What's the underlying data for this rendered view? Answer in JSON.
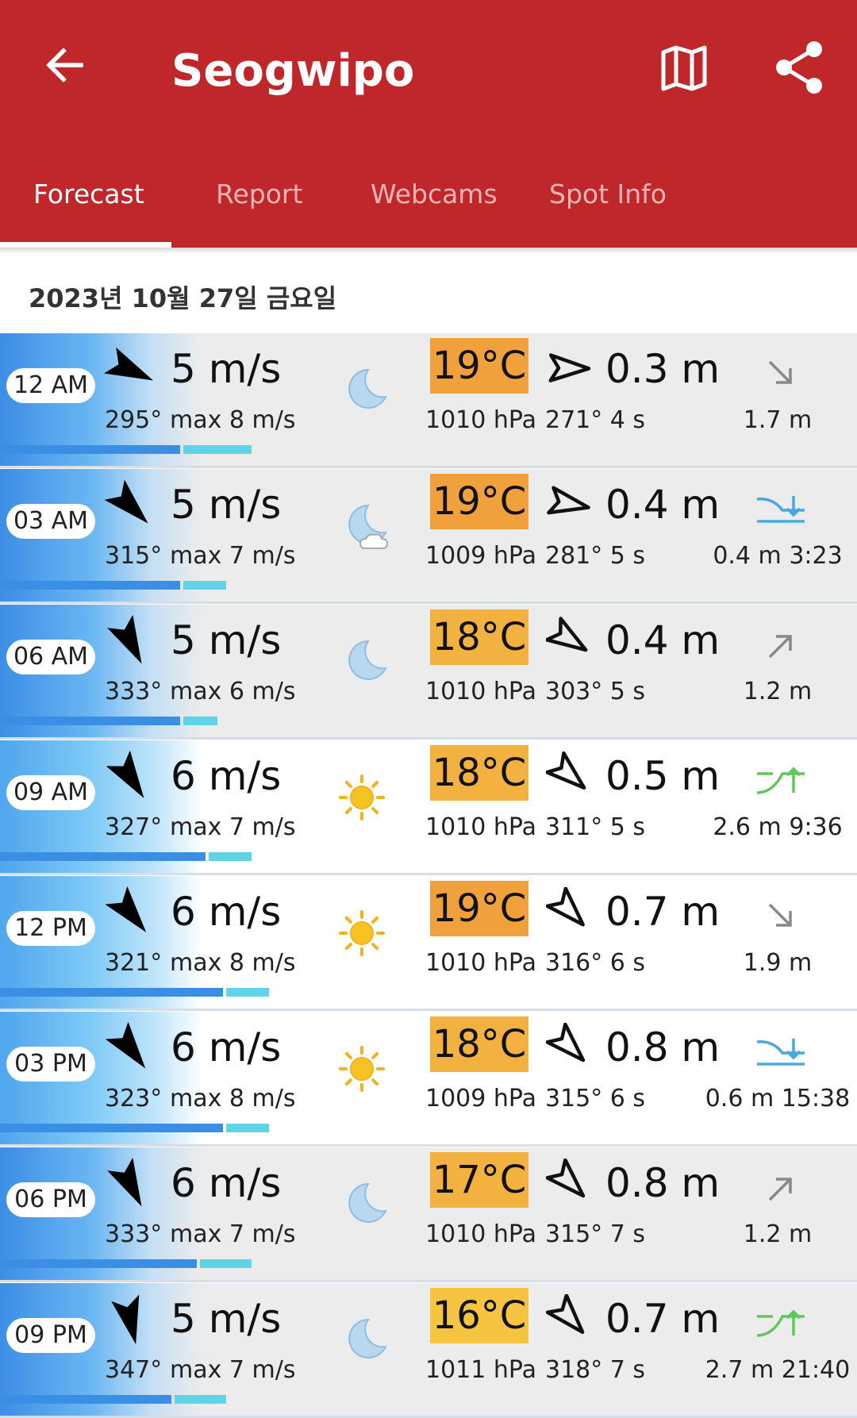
{
  "app": {
    "title": "Seogwipo",
    "icons": {
      "back": "arrow-left-icon",
      "map": "map-icon",
      "share": "share-icon"
    }
  },
  "tabs": [
    {
      "label": "Forecast",
      "active": true
    },
    {
      "label": "Report",
      "active": false
    },
    {
      "label": "Webcams",
      "active": false
    },
    {
      "label": "Spot Info",
      "active": false
    }
  ],
  "date": "2023년 10월 27일 금요일",
  "colors": {
    "appbar": "#bf272a",
    "temp_orange": "#f0a13c",
    "temp_light_orange": "#f3b23f",
    "temp_yellow": "#f5c542",
    "wind_bar": "#3a8fe5",
    "gust_bar": "#5fd4e6",
    "tide_rising": "#5ec85a",
    "tide_falling": "#4aa8e0"
  },
  "forecast": [
    {
      "time": "12 AM",
      "wind_speed": "5 m/s",
      "wind_deg": "295°",
      "wind_max": "max 8 m/s",
      "wind_dir": 295,
      "wind_frac": 0.21,
      "gust_frac": 0.29,
      "weather": "moon-icon",
      "period": "night",
      "temp": "19°C",
      "temp_color": "#f0a13c",
      "pressure": "1010 hPa",
      "swell_height": "0.3 m",
      "swell_info": "271° 4 s",
      "swell_dir": 271,
      "tide_type": "arrow-down-right-icon",
      "tide_text": "1.7 m"
    },
    {
      "time": "03 AM",
      "wind_speed": "5 m/s",
      "wind_deg": "315°",
      "wind_max": "max 7 m/s",
      "wind_dir": 315,
      "wind_frac": 0.21,
      "gust_frac": 0.26,
      "weather": "moon-cloud-icon",
      "period": "night",
      "temp": "19°C",
      "temp_color": "#f0a13c",
      "pressure": "1009 hPa",
      "swell_height": "0.4 m",
      "swell_info": "281° 5 s",
      "swell_dir": 281,
      "tide_type": "low-tide-icon",
      "tide_text": "0.4 m 3:23"
    },
    {
      "time": "06 AM",
      "wind_speed": "5 m/s",
      "wind_deg": "333°",
      "wind_max": "max 6 m/s",
      "wind_dir": 333,
      "wind_frac": 0.21,
      "gust_frac": 0.25,
      "weather": "moon-icon",
      "period": "night",
      "temp": "18°C",
      "temp_color": "#f3b23f",
      "pressure": "1010 hPa",
      "swell_height": "0.4 m",
      "swell_info": "303° 5 s",
      "swell_dir": 303,
      "tide_type": "arrow-up-right-icon",
      "tide_text": "1.2 m"
    },
    {
      "time": "09 AM",
      "wind_speed": "6 m/s",
      "wind_deg": "327°",
      "wind_max": "max 7 m/s",
      "wind_dir": 327,
      "wind_frac": 0.24,
      "gust_frac": 0.29,
      "weather": "sun-icon",
      "period": "day",
      "temp": "18°C",
      "temp_color": "#f3b23f",
      "pressure": "1010 hPa",
      "swell_height": "0.5 m",
      "swell_info": "311° 5 s",
      "swell_dir": 311,
      "tide_type": "high-tide-icon",
      "tide_text": "2.6 m 9:36"
    },
    {
      "time": "12 PM",
      "wind_speed": "6 m/s",
      "wind_deg": "321°",
      "wind_max": "max 8 m/s",
      "wind_dir": 321,
      "wind_frac": 0.26,
      "gust_frac": 0.31,
      "weather": "sun-icon",
      "period": "day",
      "temp": "19°C",
      "temp_color": "#f0a13c",
      "pressure": "1010 hPa",
      "swell_height": "0.7 m",
      "swell_info": "316° 6 s",
      "swell_dir": 316,
      "tide_type": "arrow-down-right-icon",
      "tide_text": "1.9 m"
    },
    {
      "time": "03 PM",
      "wind_speed": "6 m/s",
      "wind_deg": "323°",
      "wind_max": "max 8 m/s",
      "wind_dir": 323,
      "wind_frac": 0.26,
      "gust_frac": 0.31,
      "weather": "sun-icon",
      "period": "day",
      "temp": "18°C",
      "temp_color": "#f3b23f",
      "pressure": "1009 hPa",
      "swell_height": "0.8 m",
      "swell_info": "315° 6 s",
      "swell_dir": 315,
      "tide_type": "low-tide-icon",
      "tide_text": "0.6 m 15:38"
    },
    {
      "time": "06 PM",
      "wind_speed": "6 m/s",
      "wind_deg": "333°",
      "wind_max": "max 7 m/s",
      "wind_dir": 333,
      "wind_frac": 0.23,
      "gust_frac": 0.29,
      "weather": "moon-icon",
      "period": "night",
      "temp": "17°C",
      "temp_color": "#f3b23f",
      "pressure": "1010 hPa",
      "swell_height": "0.8 m",
      "swell_info": "315° 7 s",
      "swell_dir": 315,
      "tide_type": "arrow-up-right-icon",
      "tide_text": "1.2 m"
    },
    {
      "time": "09 PM",
      "wind_speed": "5 m/s",
      "wind_deg": "347°",
      "wind_max": "max 7 m/s",
      "wind_dir": 347,
      "wind_frac": 0.2,
      "gust_frac": 0.26,
      "weather": "moon-icon",
      "period": "night",
      "temp": "16°C",
      "temp_color": "#f5c542",
      "pressure": "1011 hPa",
      "swell_height": "0.7 m",
      "swell_info": "318° 7 s",
      "swell_dir": 318,
      "tide_type": "high-tide-icon",
      "tide_text": "2.7 m 21:40"
    }
  ]
}
